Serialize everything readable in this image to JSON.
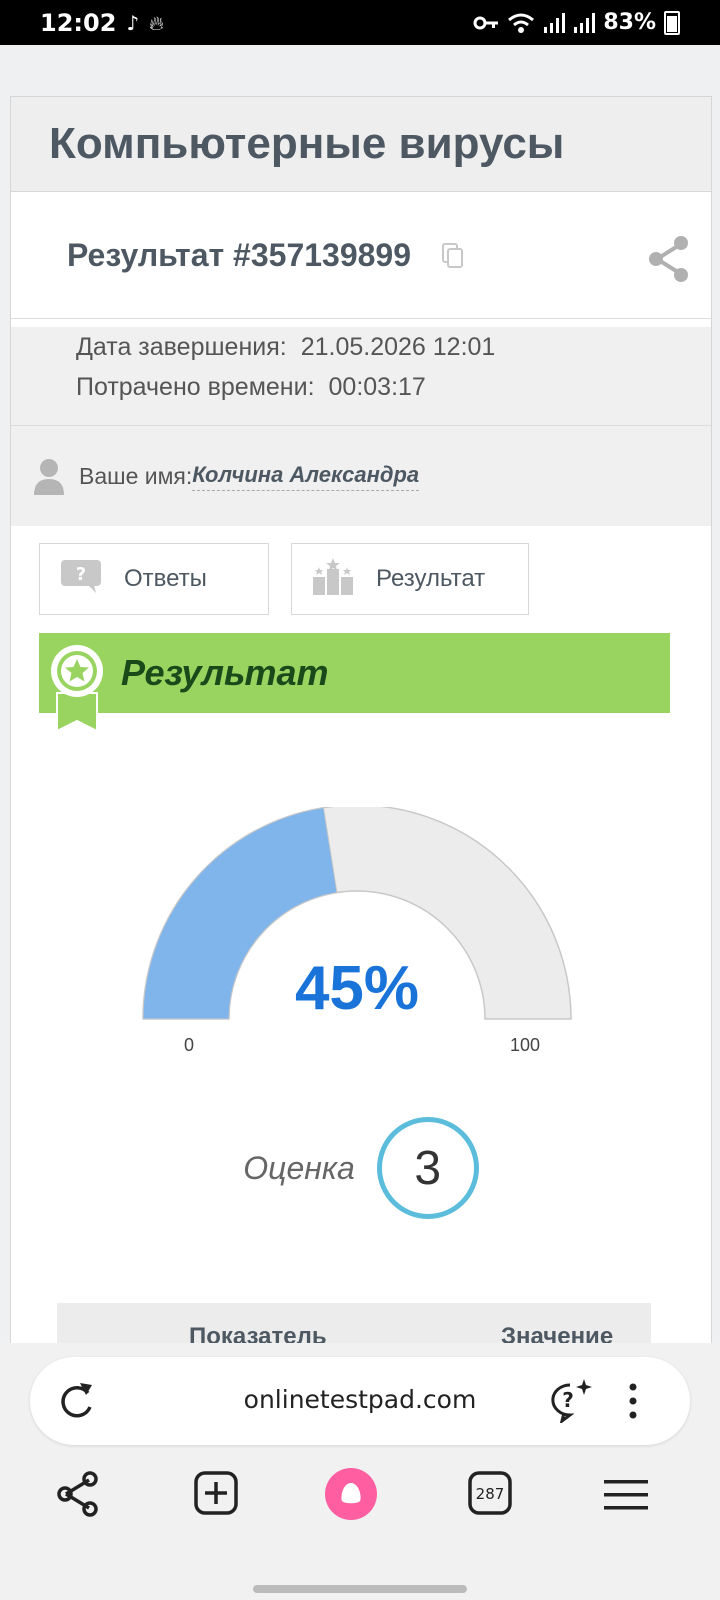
{
  "status_bar": {
    "time": "12:02",
    "battery": "83%"
  },
  "page": {
    "title": "Компьютерные вирусы",
    "result_title": "Результат #357139899",
    "meta": {
      "finish_label": "Дата завершения:",
      "finish_value": "21.05.2026 12:01",
      "time_label": "Потрачено времени:",
      "time_value": "00:03:17"
    },
    "name_label": "Ваше имя:",
    "name_value": "Колчина Александра",
    "tabs": [
      {
        "label": "Ответы",
        "icon": "question-bubble-icon"
      },
      {
        "label": "Результат",
        "icon": "podium-icon"
      }
    ],
    "banner_title": "Результат",
    "gauge": {
      "percent": 45,
      "display": "45%",
      "min_label": "0",
      "max_label": "100",
      "fill_color": "#7fb5ea",
      "track_color": "#ececec",
      "text_color": "#1a73d9"
    },
    "score": {
      "label": "Оценка",
      "value": "3"
    },
    "table": {
      "col_indicator": "Показатель",
      "col_value": "Значение"
    }
  },
  "browser": {
    "url": "onlinetestpad.com",
    "tab_count": "287"
  }
}
